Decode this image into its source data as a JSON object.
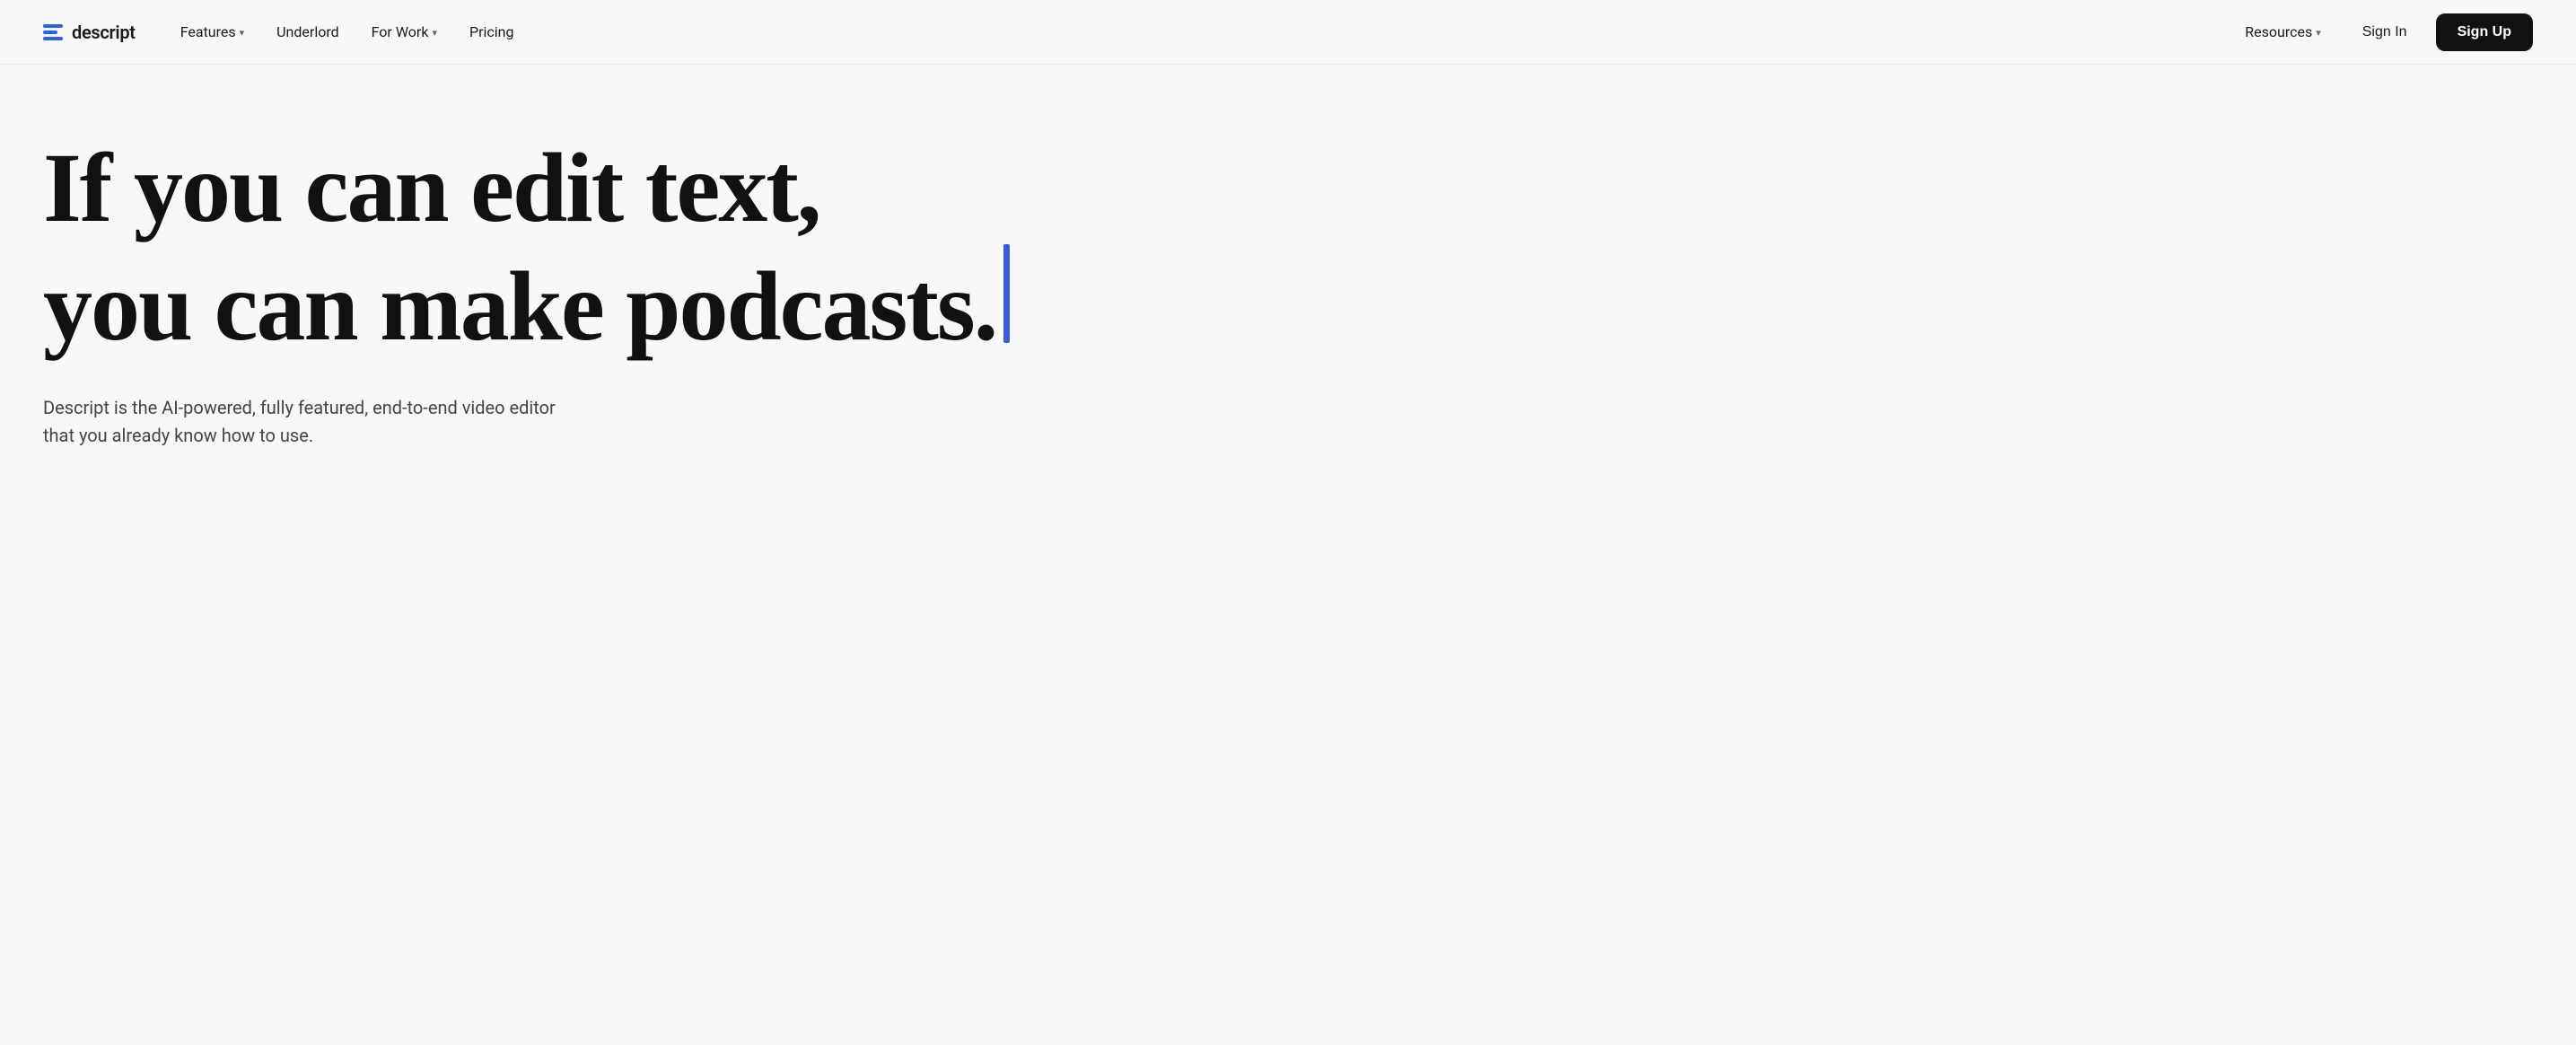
{
  "nav": {
    "logo": {
      "text": "descript"
    },
    "links": [
      {
        "label": "Features",
        "hasChevron": true
      },
      {
        "label": "Underlord",
        "hasChevron": false
      },
      {
        "label": "For Work",
        "hasChevron": true
      },
      {
        "label": "Pricing",
        "hasChevron": false
      }
    ],
    "right_links": [
      {
        "label": "Resources",
        "hasChevron": true
      },
      {
        "label": "Sign In",
        "hasChevron": false
      }
    ],
    "signup_label": "Sign Up"
  },
  "hero": {
    "headline_line1": "If you can edit text,",
    "headline_line2": "you can make podcasts.",
    "subtext_line1": "Descript is the AI-powered, fully featured, end-to-end video editor",
    "subtext_line2": "that you already know how to use.",
    "cursor_color": "#3b5bdb"
  }
}
